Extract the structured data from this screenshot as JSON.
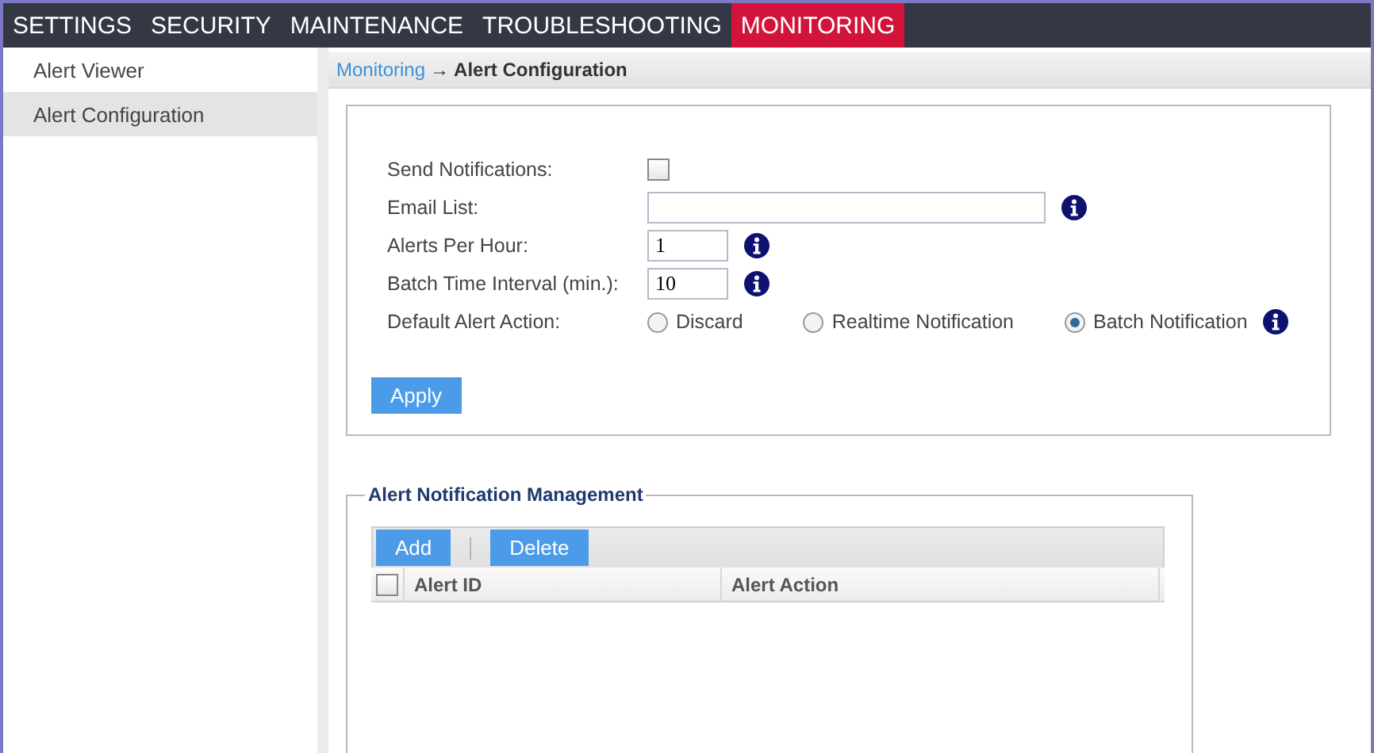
{
  "nav_tabs": [
    {
      "label": "SETTINGS",
      "selected": false
    },
    {
      "label": "SECURITY",
      "selected": false
    },
    {
      "label": "MAINTENANCE",
      "selected": false
    },
    {
      "label": "TROUBLESHOOTING",
      "selected": false
    },
    {
      "label": "MONITORING",
      "selected": true
    }
  ],
  "sidebar": {
    "items": [
      {
        "label": "Alert Viewer",
        "selected": false
      },
      {
        "label": "Alert Configuration",
        "selected": true
      }
    ]
  },
  "breadcrumb": {
    "link": "Monitoring",
    "separator": "→",
    "current": "Alert Configuration"
  },
  "form": {
    "fields": [
      {
        "kind": "checkbox",
        "label": "Send Notifications:",
        "checked": false
      },
      {
        "kind": "long_text",
        "label": "Email List:",
        "info": true
      },
      {
        "kind": "short_text",
        "label": "Alerts Per Hour:",
        "value": "1",
        "info": true
      },
      {
        "kind": "short_text",
        "label": "Batch Time Interval (min.):",
        "value": "10",
        "info": true
      },
      {
        "kind": "radio",
        "label": "Default Alert Action:",
        "info": true,
        "options": [
          {
            "label": "Discard",
            "selected": false
          },
          {
            "label": "Realtime Notification",
            "selected": false
          },
          {
            "label": "Batch Notification",
            "selected": true
          }
        ]
      }
    ],
    "apply_button": "Apply"
  },
  "management": {
    "title": "Alert Notification Management",
    "toolbar": [
      "Add",
      "Delete"
    ],
    "table": {
      "select_all_checked": false,
      "columns": [
        "Alert ID",
        "Alert Action"
      ]
    }
  }
}
